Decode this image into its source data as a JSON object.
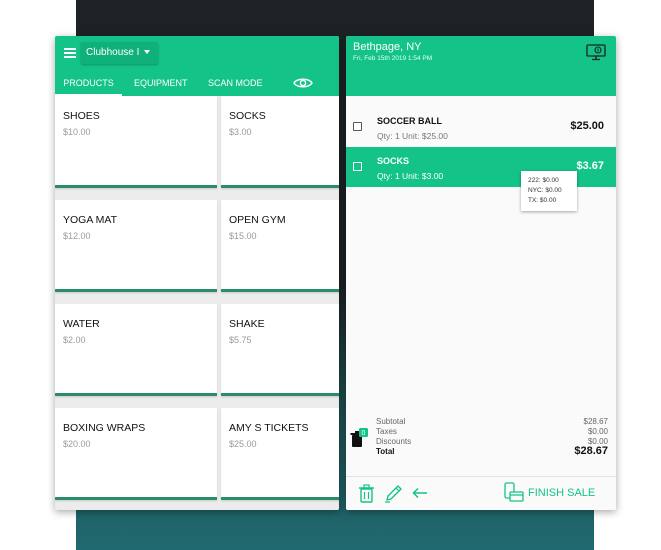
{
  "colors": {
    "accent": "#14c387",
    "card_underline": "#2a8c6a",
    "background_dark": "#1c2226"
  },
  "left": {
    "location_select": "Clubhouse I",
    "tabs": [
      {
        "label": "PRODUCTS",
        "active": true
      },
      {
        "label": "EQUIPMENT",
        "active": false
      },
      {
        "label": "SCAN MODE",
        "active": false
      }
    ],
    "products": [
      {
        "name": "SHOES",
        "price": "$10.00"
      },
      {
        "name": "SOCKS",
        "price": "$3.00"
      },
      {
        "name": "YOGA MAT",
        "price": "$12.00"
      },
      {
        "name": "OPEN GYM",
        "price": "$15.00"
      },
      {
        "name": "WATER",
        "price": "$2.00"
      },
      {
        "name": "SHAKE",
        "price": "$5.75"
      },
      {
        "name": "BOXING WRAPS",
        "price": "$20.00"
      },
      {
        "name": "AMY S TICKETS",
        "price": "$25.00"
      }
    ],
    "icons": {
      "menu": "hamburger-icon",
      "visibility": "eye-icon"
    }
  },
  "right": {
    "location": "Bethpage, NY",
    "datetime": "Fri, Feb 15th 2019  1:54 PM",
    "cart": [
      {
        "name": "SOCCER BALL",
        "detail": "Qty: 1   Unit: $25.00",
        "total": "$25.00",
        "selected": false
      },
      {
        "name": "SOCKS",
        "detail": "Qty: 1   Unit: $3.00",
        "total": "$3.67",
        "selected": true
      }
    ],
    "tax_breakdown": [
      "222: $0.00",
      "NYC: $0.00",
      "TX: $0.00"
    ],
    "discount_badge": "0",
    "summary": {
      "subtotal_label": "Subtotal",
      "subtotal": "$28.67",
      "taxes_label": "Taxes",
      "taxes": "$0.00",
      "discounts_label": "Discounts",
      "discounts": "$0.00",
      "total_label": "Total",
      "total": "$28.67"
    },
    "finish_label": "FINISH SALE",
    "icons": {
      "register": "register-icon",
      "delete": "trash-icon",
      "edit": "pencil-icon",
      "back": "arrow-left-icon",
      "finish": "payment-icon"
    }
  }
}
